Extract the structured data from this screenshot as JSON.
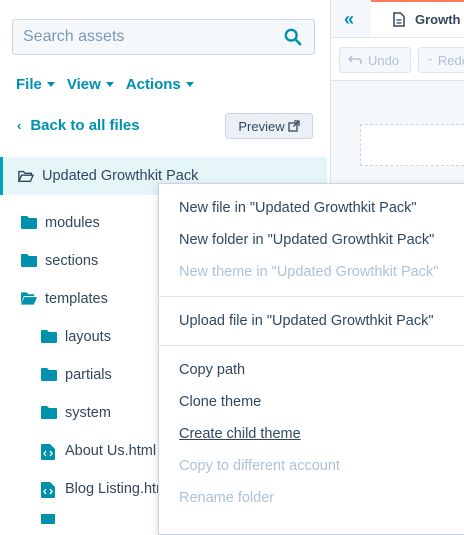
{
  "search": {
    "placeholder": "Search assets"
  },
  "menus": [
    {
      "label": "File"
    },
    {
      "label": "View"
    },
    {
      "label": "Actions"
    }
  ],
  "back_link": "Back to all files",
  "preview_button": "Preview",
  "tree": {
    "root": "Updated Growthkit Pack",
    "items": [
      {
        "label": "modules"
      },
      {
        "label": "sections"
      },
      {
        "label": "templates"
      },
      {
        "label": "layouts"
      },
      {
        "label": "partials"
      },
      {
        "label": "system"
      },
      {
        "label": "About Us.html"
      },
      {
        "label": "Blog Listing.html"
      }
    ]
  },
  "editor": {
    "tab_label": "Growth",
    "undo": "Undo",
    "redo": "Redo"
  },
  "context_menu": {
    "items": [
      {
        "label": "New file in \"Updated Growthkit Pack\"",
        "enabled": true
      },
      {
        "label": "New folder in \"Updated Growthkit Pack\"",
        "enabled": true
      },
      {
        "label": "New theme in \"Updated Growthkit Pack\"",
        "enabled": false
      },
      {
        "label": "Upload file in \"Updated Growthkit Pack\"",
        "enabled": true
      },
      {
        "label": "Copy path",
        "enabled": true
      },
      {
        "label": "Clone theme",
        "enabled": true
      },
      {
        "label": "Create child theme",
        "enabled": true
      },
      {
        "label": "Copy to different account",
        "enabled": false
      },
      {
        "label": "Rename folder",
        "enabled": false
      }
    ]
  },
  "colors": {
    "accent": "#0091ae",
    "folder": "#0091ae",
    "text": "#33475b",
    "disabled": "#b0c1d4",
    "tab_accent": "#ff7a59"
  }
}
